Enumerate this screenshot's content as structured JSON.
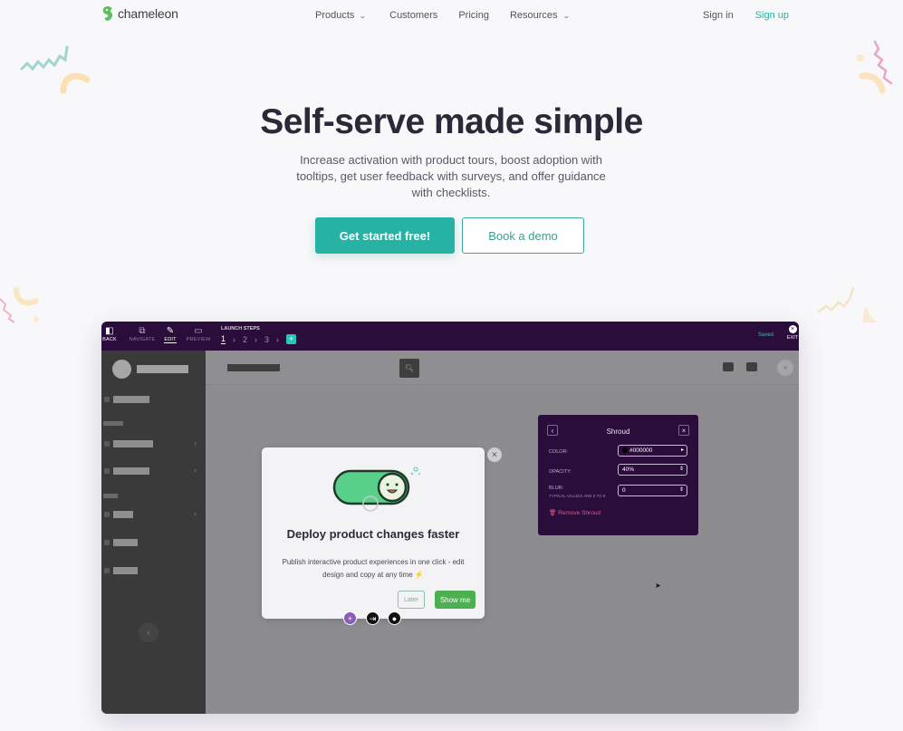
{
  "nav": {
    "logo_text": "chameleon",
    "links": [
      {
        "label": "Products",
        "has_dropdown": true
      },
      {
        "label": "Customers",
        "has_dropdown": false
      },
      {
        "label": "Pricing",
        "has_dropdown": false
      },
      {
        "label": "Resources",
        "has_dropdown": true
      }
    ],
    "sign_in": "Sign in",
    "sign_up": "Sign up"
  },
  "hero": {
    "title": "Self-serve made simple",
    "subtitle": "Increase activation with product tours, boost adoption with tooltips, get user feedback with surveys, and offer guidance with checklists.",
    "primary_cta": "Get started free!",
    "secondary_cta": "Book a demo"
  },
  "colors": {
    "brand_teal": "#27b3a4",
    "editor_purple": "#2a0d3b",
    "show_me_green": "#4caf50",
    "remove_pink": "#e05a8a"
  },
  "mockup": {
    "toolbar": {
      "back": "BACK",
      "navigate": "NAVIGATE",
      "edit": "EDIT",
      "preview": "PREVIEW",
      "launch_steps": "LAUNCH STEPS",
      "steps": [
        "1",
        "2",
        "3"
      ],
      "add_step": "+",
      "saved": "Saved",
      "exit": "EXIT"
    },
    "modal": {
      "title": "Deploy product changes faster",
      "body": "Publish interactive product experiences in one click - edit design and copy at any time ⚡",
      "later": "Later",
      "show_me": "Show me"
    },
    "shroud_panel": {
      "title": "Shroud",
      "color_label": "COLOR:",
      "color_value": "#000000",
      "opacity_label": "OPACITY:",
      "opacity_value": "40%",
      "blur_label": "BLUR:",
      "blur_hint": "TYPICAL VALUES ARE 0 TO 8",
      "blur_value": "0",
      "remove": "Remove Shroud"
    }
  }
}
